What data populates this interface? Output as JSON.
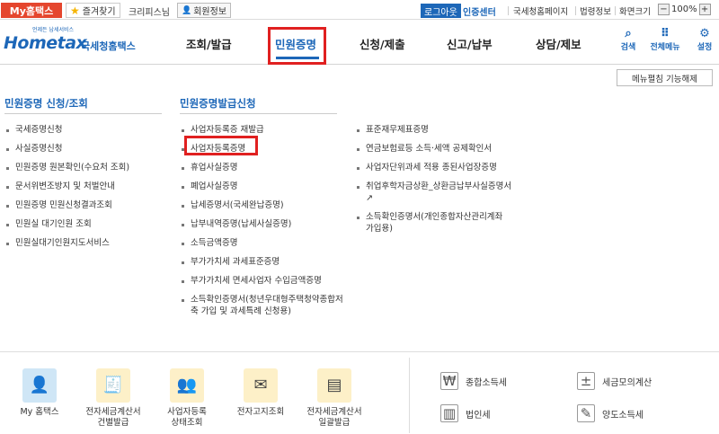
{
  "topbar": {
    "my_hometax": "My홈택스",
    "favorites": "즐겨찾기",
    "user_name": "크리피스님",
    "member_info": "회원정보",
    "logout": "로그아웃",
    "cert_center": "인증센터",
    "nts_page": "국세청홈페이지",
    "legal_info": "법령정보",
    "screen_size": "화면크기",
    "zoom_minus": "−",
    "zoom": "100%",
    "zoom_plus": "+"
  },
  "header": {
    "logo_small": "언제든 납세서비스",
    "logo_text": "Hometax",
    "logo_sub": "국세청홈택스",
    "nav": [
      "조회/발급",
      "민원증명",
      "신청/제출",
      "신고/납부",
      "상담/제보"
    ],
    "active_nav": "민원증명",
    "search": "검색",
    "all_menu": "전체메뉴",
    "settings": "설정"
  },
  "menu_close": "메뉴펼침 기능해제",
  "left_section": {
    "title": "민원증명 신청/조회",
    "items": [
      "국세증명신청",
      "사실증명신청",
      "민원증명 원본확인(수요처 조회)",
      "문서위변조방지 및 처벌안내",
      "민원증명 민원신청결과조회",
      "민원실 대기인원 조회",
      "민원실대기인원지도서비스"
    ]
  },
  "mid_section": {
    "title": "민원증명발급신청",
    "items": [
      "사업자등록증 재발급",
      "사업자등록증명",
      "휴업사실증명",
      "폐업사실증명",
      "납세증명서(국세완납증명)",
      "납부내역증명(납세사실증명)",
      "소득금액증명",
      "부가가치세 과세표준증명",
      "부가가치세 면세사업자 수입금액증명",
      "소득확인증명서(청년우대형주택청약종합저축 가입 및 과세특례 신청용)"
    ]
  },
  "right_section": {
    "items": [
      "표준재무제표증명",
      "연금보험료등 소득·세액 공제확인서",
      "사업자단위과세 적용 종된사업장증명",
      "취업후학자금상환_상환금납부사실증명서",
      "소득확인증명서(개인종합자산관리계좌 가입용)"
    ]
  },
  "quick": [
    {
      "label": "My 홈택스",
      "icon": "person-icon"
    },
    {
      "label": "전자세금계산서\n건별발급",
      "icon": "invoice-icon"
    },
    {
      "label": "사업자등록\n상태조회",
      "icon": "users-icon"
    },
    {
      "label": "전자고지조회",
      "icon": "mail-icon"
    },
    {
      "label": "전자세금계산서\n일괄발급",
      "icon": "batch-invoice-icon"
    }
  ],
  "tax_links": [
    {
      "label": "종합소득세",
      "icon": "income-tax-icon"
    },
    {
      "label": "세금모의계산",
      "icon": "calculator-icon"
    },
    {
      "label": "법인세",
      "icon": "building-icon"
    },
    {
      "label": "양도소득세",
      "icon": "transfer-icon"
    }
  ]
}
